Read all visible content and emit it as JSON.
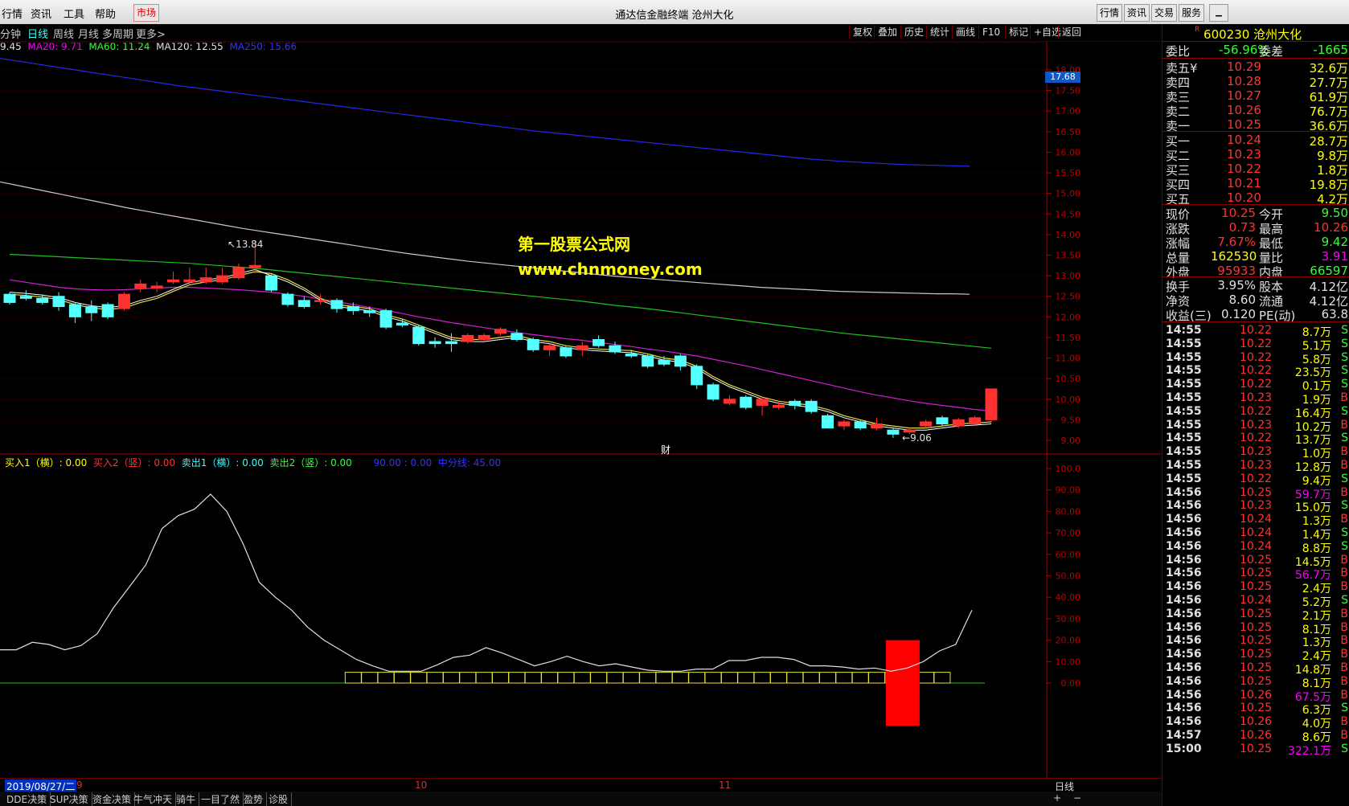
{
  "menu": {
    "items": [
      "行情",
      "资讯",
      "工具",
      "帮助"
    ],
    "market_btn": "市场"
  },
  "window_title": "通达信金融终端  沧州大化",
  "right_buttons": [
    "行情",
    "资讯",
    "交易",
    "服务"
  ],
  "periods": {
    "items": [
      "分钟",
      "日线",
      "周线",
      "月线",
      "多周期",
      "更多>"
    ],
    "selected": "日线"
  },
  "tools": [
    "复权",
    "叠加",
    "历史",
    "统计",
    "画线",
    "F10",
    "标记",
    "+自选",
    "返回"
  ],
  "ma_legend": {
    "ma5": "9.45",
    "ma20": "MA20: 9.71",
    "ma60": "MA60: 11.24",
    "ma120": "MA120: 12.55",
    "ma250": "MA250: 15.66"
  },
  "price_axis": [
    "18.00",
    "17.50",
    "17.00",
    "16.50",
    "16.00",
    "15.50",
    "15.00",
    "14.50",
    "14.00",
    "13.50",
    "13.00",
    "12.50",
    "12.00",
    "11.50",
    "11.00",
    "10.50",
    "10.00",
    "9.50",
    "9.00"
  ],
  "price_tag": "17.68",
  "annotations": {
    "high": "13.84",
    "low": "9.06",
    "cai": "财"
  },
  "watermark": {
    "line1": "第一股票公式网",
    "line2": "www.chnmoney.com"
  },
  "indicator_legend": {
    "buy1": "买入1（横）: 0.00",
    "buy2": "买入2（竖）: 0.00",
    "sell1": "卖出1（横）: 0.00",
    "sell2": "卖出2（竖）: 0.00",
    "v1": "90.00",
    "v2": ": 0.00",
    "mid": "中分线: 45.00"
  },
  "ind_axis": [
    "100.0",
    "90.00",
    "80.00",
    "70.00",
    "60.00",
    "50.00",
    "40.00",
    "30.00",
    "20.00",
    "10.00",
    "0.00"
  ],
  "date_bar": {
    "start": "2019/08/27/二",
    "m9": "9",
    "m10": "10",
    "m11": "11",
    "period": "日线"
  },
  "bottom_tabs": [
    "DDE决策",
    "SUP决策",
    "资金决策",
    "牛气冲天",
    "骑牛",
    "一目了然",
    "盈势",
    "诊股"
  ],
  "quote": {
    "code": "600230",
    "name": "沧州大化",
    "r": "R",
    "weibi_label": "委比",
    "weibi": "-56.96%",
    "weicha_label": "委差",
    "weicha": "-1665",
    "asks": [
      {
        "label": "卖五",
        "sym": "¥",
        "price": "10.29",
        "vol": "32.6万"
      },
      {
        "label": "卖四",
        "price": "10.28",
        "vol": "27.7万"
      },
      {
        "label": "卖三",
        "price": "10.27",
        "vol": "61.9万"
      },
      {
        "label": "卖二",
        "price": "10.26",
        "vol": "76.7万"
      },
      {
        "label": "卖一",
        "price": "10.25",
        "vol": "36.6万"
      }
    ],
    "bids": [
      {
        "label": "买一",
        "price": "10.24",
        "vol": "28.7万"
      },
      {
        "label": "买二",
        "price": "10.23",
        "vol": "9.8万"
      },
      {
        "label": "买三",
        "price": "10.22",
        "vol": "1.8万"
      },
      {
        "label": "买四",
        "price": "10.21",
        "vol": "19.8万"
      },
      {
        "label": "买五",
        "price": "10.20",
        "vol": "4.2万"
      }
    ],
    "stats": [
      {
        "l1": "现价",
        "v1": "10.25",
        "l2": "今开",
        "v2": "9.50"
      },
      {
        "l1": "涨跌",
        "v1": "0.73",
        "l2": "最高",
        "v2": "10.26"
      },
      {
        "l1": "涨幅",
        "v1": "7.67%",
        "l2": "最低",
        "v2": "9.42"
      },
      {
        "l1": "总量",
        "v1": "162530",
        "l2": "量比",
        "v2": "3.91"
      },
      {
        "l1": "外盘",
        "v1": "95933",
        "l2": "内盘",
        "v2": "66597"
      }
    ],
    "stats2": [
      {
        "l1": "换手",
        "v1": "3.95%",
        "l2": "股本",
        "v2": "4.12亿"
      },
      {
        "l1": "净资",
        "v1": "8.60",
        "l2": "流通",
        "v2": "4.12亿"
      },
      {
        "l1": "收益(三)",
        "v1": "0.120",
        "l2": "PE(动)",
        "v2": "63.8"
      }
    ]
  },
  "ticks": [
    {
      "t": "14:55",
      "p": "10.22",
      "v": "8.7万",
      "s": "S"
    },
    {
      "t": "14:55",
      "p": "10.22",
      "v": "5.1万",
      "s": "S"
    },
    {
      "t": "14:55",
      "p": "10.22",
      "v": "5.8万",
      "s": "S"
    },
    {
      "t": "14:55",
      "p": "10.22",
      "v": "23.5万",
      "s": "S"
    },
    {
      "t": "14:55",
      "p": "10.22",
      "v": "0.1万",
      "s": "S"
    },
    {
      "t": "14:55",
      "p": "10.23",
      "v": "1.9万",
      "s": "B"
    },
    {
      "t": "14:55",
      "p": "10.22",
      "v": "16.4万",
      "s": "S"
    },
    {
      "t": "14:55",
      "p": "10.23",
      "v": "10.2万",
      "s": "B"
    },
    {
      "t": "14:55",
      "p": "10.22",
      "v": "13.7万",
      "s": "S"
    },
    {
      "t": "14:55",
      "p": "10.23",
      "v": "1.0万",
      "s": "B"
    },
    {
      "t": "14:55",
      "p": "10.23",
      "v": "12.8万",
      "s": "B"
    },
    {
      "t": "14:55",
      "p": "10.22",
      "v": "9.4万",
      "s": "S"
    },
    {
      "t": "14:56",
      "p": "10.25",
      "v": "59.7万",
      "s": "B"
    },
    {
      "t": "14:56",
      "p": "10.23",
      "v": "15.0万",
      "s": "S"
    },
    {
      "t": "14:56",
      "p": "10.24",
      "v": "1.3万",
      "s": "B"
    },
    {
      "t": "14:56",
      "p": "10.24",
      "v": "1.4万",
      "s": "S"
    },
    {
      "t": "14:56",
      "p": "10.24",
      "v": "8.8万",
      "s": "S"
    },
    {
      "t": "14:56",
      "p": "10.25",
      "v": "14.5万",
      "s": "B"
    },
    {
      "t": "14:56",
      "p": "10.25",
      "v": "56.7万",
      "s": "B"
    },
    {
      "t": "14:56",
      "p": "10.25",
      "v": "2.4万",
      "s": "B"
    },
    {
      "t": "14:56",
      "p": "10.24",
      "v": "5.2万",
      "s": "S"
    },
    {
      "t": "14:56",
      "p": "10.25",
      "v": "2.1万",
      "s": "B"
    },
    {
      "t": "14:56",
      "p": "10.25",
      "v": "8.1万",
      "s": "B"
    },
    {
      "t": "14:56",
      "p": "10.25",
      "v": "1.3万",
      "s": "B"
    },
    {
      "t": "14:56",
      "p": "10.25",
      "v": "2.4万",
      "s": "B"
    },
    {
      "t": "14:56",
      "p": "10.25",
      "v": "14.8万",
      "s": "B"
    },
    {
      "t": "14:56",
      "p": "10.25",
      "v": "8.1万",
      "s": "B"
    },
    {
      "t": "14:56",
      "p": "10.26",
      "v": "67.5万",
      "s": "B"
    },
    {
      "t": "14:56",
      "p": "10.25",
      "v": "6.3万",
      "s": "S"
    },
    {
      "t": "14:56",
      "p": "10.26",
      "v": "4.0万",
      "s": "B"
    },
    {
      "t": "14:57",
      "p": "10.26",
      "v": "8.6万",
      "s": "B"
    },
    {
      "t": "15:00",
      "p": "10.25",
      "v": "322.1万",
      "s": "S"
    }
  ],
  "chart_data": {
    "type": "candlestick",
    "ylim": [
      9.0,
      18.0
    ],
    "candles": [
      [
        12.55,
        12.35,
        12.6,
        12.3
      ],
      [
        12.5,
        12.45,
        12.65,
        12.4
      ],
      [
        12.45,
        12.35,
        12.55,
        12.3
      ],
      [
        12.5,
        12.25,
        12.6,
        12.15
      ],
      [
        12.3,
        12.0,
        12.35,
        11.85
      ],
      [
        12.25,
        12.1,
        12.4,
        11.9
      ],
      [
        12.3,
        12.0,
        12.35,
        11.95
      ],
      [
        12.2,
        12.55,
        12.6,
        12.15
      ],
      [
        12.7,
        12.8,
        12.9,
        12.6
      ],
      [
        12.7,
        12.75,
        12.85,
        12.6
      ],
      [
        12.85,
        12.9,
        13.1,
        12.8
      ],
      [
        12.85,
        12.9,
        13.2,
        12.8
      ],
      [
        12.85,
        12.95,
        13.2,
        12.8
      ],
      [
        12.85,
        13.0,
        13.2,
        12.8
      ],
      [
        12.95,
        13.2,
        13.3,
        12.9
      ],
      [
        13.2,
        13.25,
        13.84,
        13.05
      ],
      [
        13.0,
        12.65,
        13.05,
        12.6
      ],
      [
        12.55,
        12.3,
        12.6,
        12.25
      ],
      [
        12.4,
        12.25,
        12.5,
        12.2
      ],
      [
        12.4,
        12.4,
        12.55,
        12.3
      ],
      [
        12.4,
        12.2,
        12.45,
        12.1
      ],
      [
        12.25,
        12.15,
        12.35,
        12.05
      ],
      [
        12.15,
        12.1,
        12.25,
        12.0
      ],
      [
        12.15,
        11.75,
        12.2,
        11.7
      ],
      [
        11.85,
        11.8,
        11.95,
        11.75
      ],
      [
        11.75,
        11.35,
        11.8,
        11.3
      ],
      [
        11.4,
        11.35,
        11.5,
        11.25
      ],
      [
        11.4,
        11.35,
        11.6,
        11.15
      ],
      [
        11.4,
        11.55,
        11.6,
        11.35
      ],
      [
        11.45,
        11.55,
        11.6,
        11.4
      ],
      [
        11.6,
        11.7,
        11.75,
        11.55
      ],
      [
        11.6,
        11.45,
        11.7,
        11.4
      ],
      [
        11.45,
        11.2,
        11.5,
        11.15
      ],
      [
        11.2,
        11.3,
        11.35,
        11.05
      ],
      [
        11.25,
        11.05,
        11.3,
        11.0
      ],
      [
        11.2,
        11.3,
        11.4,
        11.05
      ],
      [
        11.45,
        11.3,
        11.55,
        11.25
      ],
      [
        11.3,
        11.15,
        11.4,
        11.1
      ],
      [
        11.1,
        11.05,
        11.2,
        11.0
      ],
      [
        11.05,
        10.8,
        11.1,
        10.75
      ],
      [
        10.95,
        10.85,
        11.05,
        10.8
      ],
      [
        11.05,
        10.8,
        11.1,
        10.7
      ],
      [
        10.8,
        10.35,
        10.85,
        10.25
      ],
      [
        10.35,
        10.0,
        10.4,
        9.95
      ],
      [
        9.9,
        10.0,
        10.1,
        9.85
      ],
      [
        10.05,
        9.8,
        10.1,
        9.75
      ],
      [
        9.85,
        10.0,
        10.05,
        9.6
      ],
      [
        9.8,
        9.85,
        9.95,
        9.75
      ],
      [
        9.95,
        9.85,
        10.0,
        9.75
      ],
      [
        9.95,
        9.7,
        10.0,
        9.65
      ],
      [
        9.6,
        9.3,
        9.65,
        9.3
      ],
      [
        9.35,
        9.45,
        9.5,
        9.25
      ],
      [
        9.45,
        9.3,
        9.5,
        9.25
      ],
      [
        9.3,
        9.4,
        9.55,
        9.25
      ],
      [
        9.25,
        9.15,
        9.3,
        9.06
      ],
      [
        9.2,
        9.25,
        9.3,
        9.15
      ],
      [
        9.35,
        9.45,
        9.5,
        9.3
      ],
      [
        9.55,
        9.4,
        9.6,
        9.35
      ],
      [
        9.35,
        9.5,
        9.55,
        9.3
      ],
      [
        9.4,
        9.55,
        9.6,
        9.35
      ],
      [
        9.5,
        10.25,
        10.26,
        9.42
      ]
    ],
    "ma5": [
      12.55,
      12.52,
      12.48,
      12.42,
      12.3,
      12.22,
      12.18,
      12.22,
      12.35,
      12.45,
      12.62,
      12.78,
      12.85,
      12.9,
      13.0,
      13.1,
      13.05,
      12.9,
      12.7,
      12.45,
      12.3,
      12.25,
      12.2,
      12.05,
      11.95,
      11.8,
      11.65,
      11.5,
      11.45,
      11.45,
      11.5,
      11.55,
      11.45,
      11.4,
      11.3,
      11.25,
      11.22,
      11.2,
      11.18,
      11.1,
      11.0,
      10.95,
      10.8,
      10.55,
      10.35,
      10.2,
      10.05,
      9.95,
      9.9,
      9.85,
      9.75,
      9.6,
      9.5,
      9.4,
      9.35,
      9.3,
      9.3,
      9.35,
      9.4,
      9.42,
      9.45
    ],
    "ma20": [
      12.9,
      12.84,
      12.78,
      12.72,
      12.68,
      12.66,
      12.65,
      12.66,
      12.68,
      12.7,
      12.72,
      12.72,
      12.7,
      12.68,
      12.66,
      12.63,
      12.6,
      12.55,
      12.5,
      12.43,
      12.37,
      12.3,
      12.23,
      12.16,
      12.08,
      12.0,
      11.93,
      11.86,
      11.8,
      11.74,
      11.68,
      11.62,
      11.57,
      11.52,
      11.47,
      11.43,
      11.38,
      11.33,
      11.28,
      11.22,
      11.17,
      11.11,
      11.05,
      10.97,
      10.89,
      10.81,
      10.72,
      10.63,
      10.54,
      10.45,
      10.36,
      10.27,
      10.18,
      10.1,
      10.03,
      9.96,
      9.9,
      9.85,
      9.8,
      9.75,
      9.71
    ],
    "ma60": [
      13.52,
      13.5,
      13.48,
      13.46,
      13.44,
      13.42,
      13.4,
      13.38,
      13.36,
      13.34,
      13.32,
      13.3,
      13.27,
      13.24,
      13.21,
      13.18,
      13.14,
      13.1,
      13.06,
      13.02,
      12.98,
      12.94,
      12.9,
      12.86,
      12.82,
      12.78,
      12.74,
      12.7,
      12.66,
      12.62,
      12.58,
      12.54,
      12.5,
      12.46,
      12.42,
      12.38,
      12.33,
      12.28,
      12.24,
      12.2,
      12.15,
      12.1,
      12.05,
      12.0,
      11.95,
      11.9,
      11.85,
      11.8,
      11.75,
      11.7,
      11.65,
      11.6,
      11.56,
      11.52,
      11.48,
      11.44,
      11.4,
      11.36,
      11.32,
      11.28,
      11.24
    ],
    "ma120": [
      15.28,
      15.2,
      15.12,
      15.04,
      14.96,
      14.88,
      14.8,
      14.72,
      14.64,
      14.57,
      14.5,
      14.43,
      14.36,
      14.29,
      14.22,
      14.15,
      14.09,
      14.03,
      13.97,
      13.91,
      13.85,
      13.79,
      13.73,
      13.67,
      13.61,
      13.55,
      13.5,
      13.45,
      13.4,
      13.35,
      13.31,
      13.27,
      13.23,
      13.19,
      13.15,
      13.11,
      13.07,
      13.03,
      12.99,
      12.96,
      12.93,
      12.9,
      12.87,
      12.84,
      12.81,
      12.78,
      12.75,
      12.72,
      12.7,
      12.68,
      12.66,
      12.64,
      12.62,
      12.61,
      12.6,
      12.59,
      12.58,
      12.57,
      12.56,
      12.56,
      12.55
    ],
    "ma250": [
      18.28,
      18.22,
      18.16,
      18.1,
      18.04,
      17.98,
      17.92,
      17.86,
      17.8,
      17.74,
      17.68,
      17.62,
      17.57,
      17.52,
      17.47,
      17.42,
      17.37,
      17.32,
      17.27,
      17.22,
      17.17,
      17.12,
      17.07,
      17.02,
      16.97,
      16.92,
      16.87,
      16.82,
      16.77,
      16.72,
      16.67,
      16.62,
      16.57,
      16.52,
      16.48,
      16.44,
      16.4,
      16.36,
      16.32,
      16.28,
      16.24,
      16.2,
      16.16,
      16.12,
      16.08,
      16.04,
      16.0,
      15.96,
      15.92,
      15.88,
      15.84,
      15.81,
      15.78,
      15.76,
      15.74,
      15.72,
      15.7,
      15.69,
      15.68,
      15.67,
      15.66
    ],
    "indicator": {
      "ylim": [
        0,
        100
      ],
      "line": [
        15.5,
        15.5,
        19,
        18,
        15.5,
        17.5,
        23,
        35,
        45,
        55,
        72,
        78,
        81,
        88,
        80,
        65,
        47,
        40,
        34,
        26,
        20,
        15.5,
        11,
        8,
        5.5,
        5.5,
        5.5,
        8.5,
        12,
        13,
        16.5,
        14,
        11,
        8,
        10,
        12.5,
        10,
        8,
        9,
        7.5,
        6,
        5.5,
        5.5,
        6.5,
        6.5,
        10.5,
        10.5,
        12,
        12,
        11,
        8,
        8,
        7.5,
        6.5,
        7,
        5.5,
        7,
        10,
        15,
        18,
        34
      ],
      "boxes_from": 21,
      "boxes_to": 57,
      "bar_index": 54,
      "bar_top": 20,
      "bar_bottom": -20
    }
  }
}
